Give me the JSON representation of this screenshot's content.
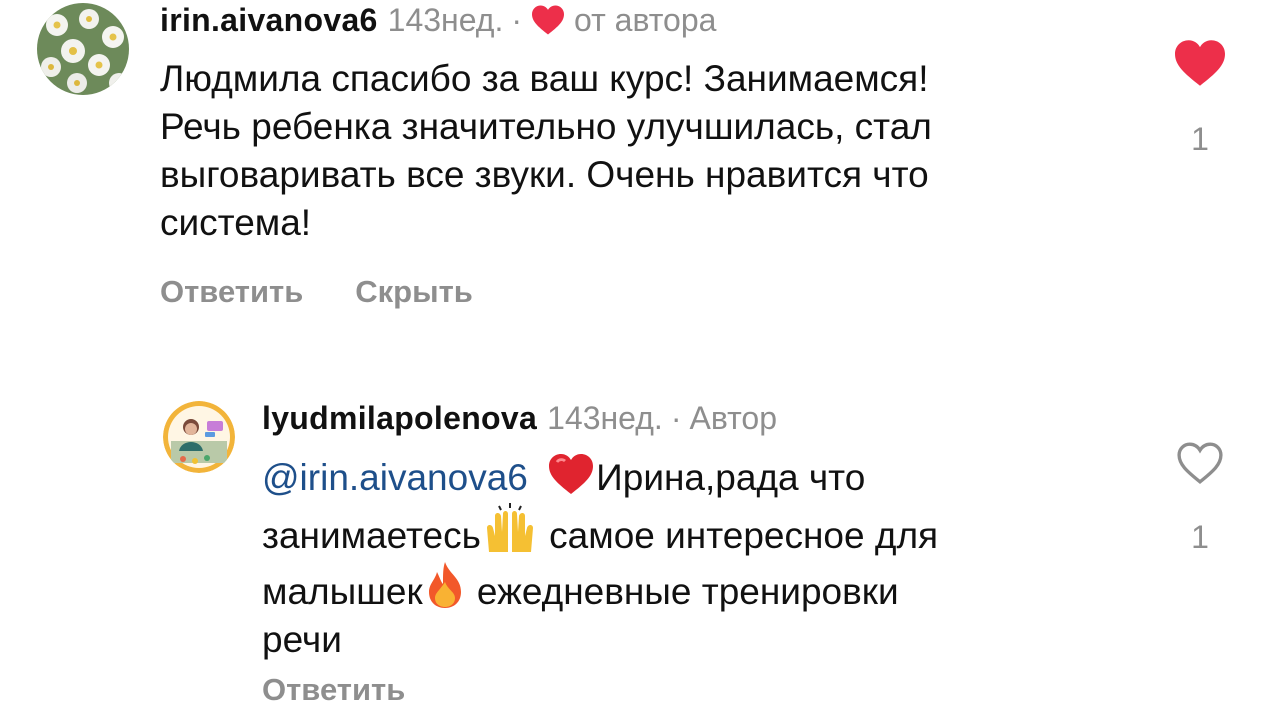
{
  "comments": [
    {
      "username": "irin.aivanova6",
      "time": "143нед.",
      "author_like_label": "от автора",
      "text_lines": [
        "Людмила спасибо за ваш курс! Занимаемся!",
        "Речь ребенка значительно улучшилась, стал",
        "выговаривать все звуки. Очень нравится что",
        "система!"
      ],
      "actions": {
        "reply": "Ответить",
        "hide": "Скрыть"
      },
      "like_count": "1",
      "liked": true
    },
    {
      "username": "lyudmilapolenova",
      "time": "143нед.",
      "author_badge": "Автор",
      "mention": "@irin.aivanova6",
      "text_line1_after": "Ирина,рада что",
      "text_line2_before": "занимаетесь",
      "text_line2_after": " самое интересное для",
      "text_line3_before": "малышек",
      "text_line3_after": " ежедневные тренировки",
      "text_line4": "речи",
      "actions": {
        "reply": "Ответить"
      },
      "like_count": "1",
      "liked": false
    }
  ],
  "icons": {
    "heart_filled": "heart-icon",
    "heart_outline": "heart-outline-icon",
    "emoji_heart": "red-heart-emoji",
    "emoji_hands": "raising-hands-emoji",
    "emoji_fire": "fire-emoji"
  },
  "colors": {
    "like_red": "#ed2f4a",
    "muted": "#8e8e8e",
    "mention": "#1e4f8a"
  }
}
